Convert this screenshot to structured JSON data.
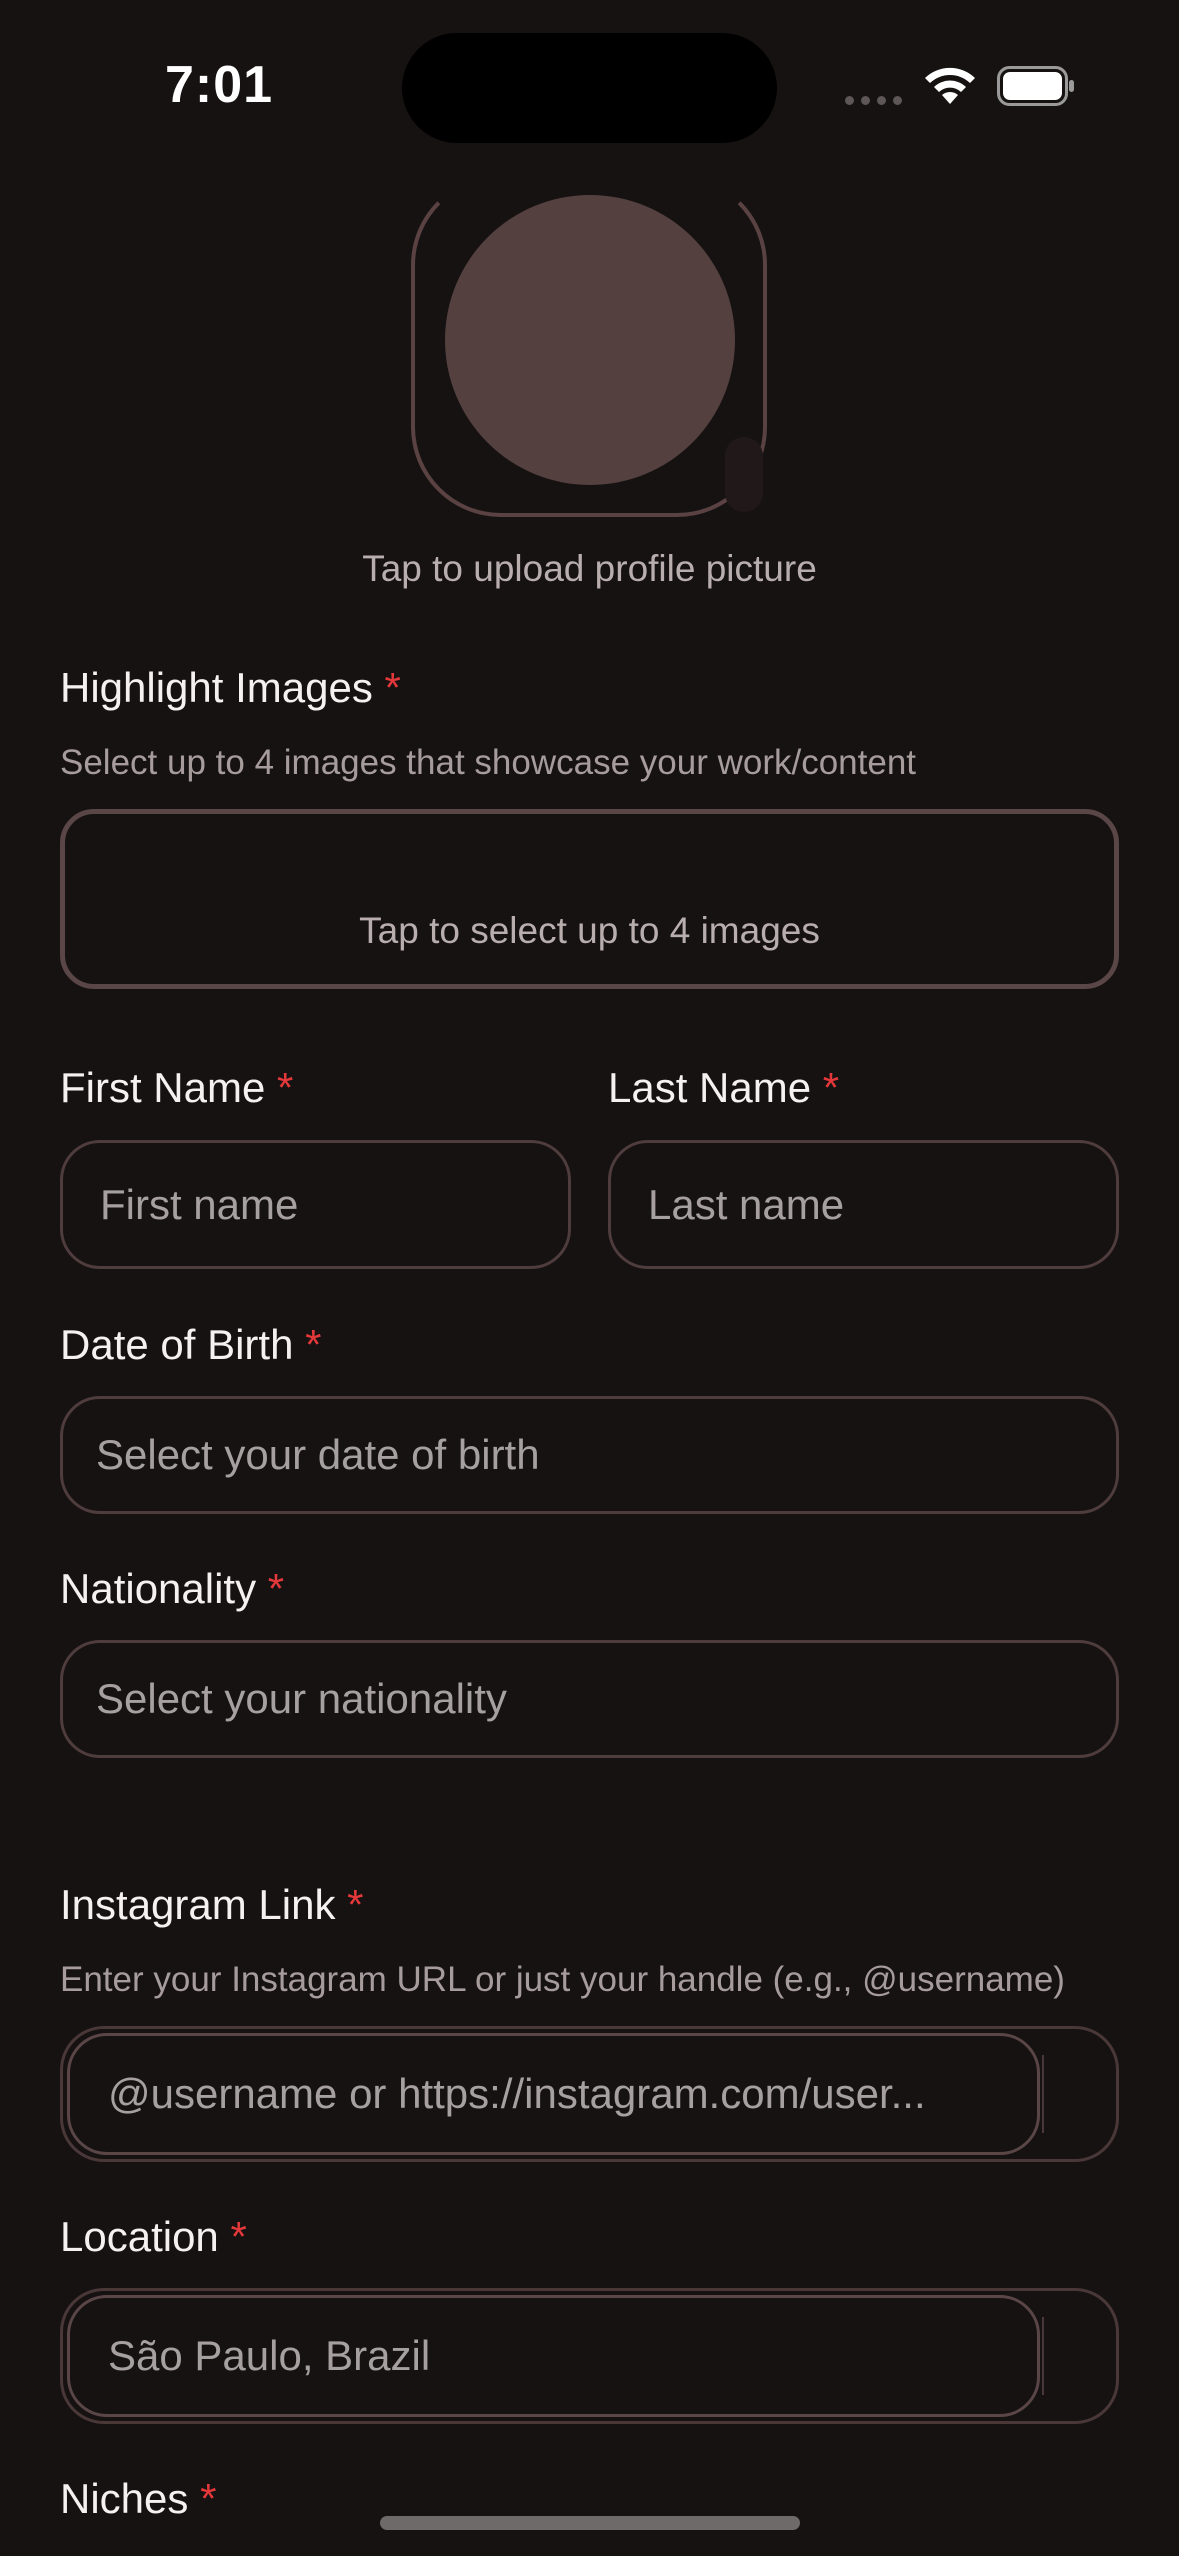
{
  "status_bar": {
    "time": "7:01"
  },
  "profile": {
    "upload_label": "Tap to upload profile picture"
  },
  "highlight": {
    "label": "Highlight Images",
    "required_mark": "*",
    "help": "Select up to 4 images that showcase your work/content",
    "box_text": "Tap to select up to 4 images"
  },
  "first_name": {
    "label": "First Name",
    "required_mark": "*",
    "placeholder": "First name"
  },
  "last_name": {
    "label": "Last Name",
    "required_mark": "*",
    "placeholder": "Last name"
  },
  "dob": {
    "label": "Date of Birth",
    "required_mark": "*",
    "placeholder": "Select your date of birth"
  },
  "nationality": {
    "label": "Nationality",
    "required_mark": "*",
    "placeholder": "Select your nationality"
  },
  "instagram": {
    "label": "Instagram Link",
    "required_mark": "*",
    "help": "Enter your Instagram URL or just your handle (e.g., @username)",
    "placeholder": "@username or https://instagram.com/user..."
  },
  "location": {
    "label": "Location",
    "required_mark": "*",
    "placeholder": "São Paulo, Brazil"
  },
  "niches": {
    "label": "Niches",
    "required_mark": "*"
  },
  "colors": {
    "background": "#171212",
    "accent_required": "#e5383b",
    "border": "#4f3c3c"
  }
}
